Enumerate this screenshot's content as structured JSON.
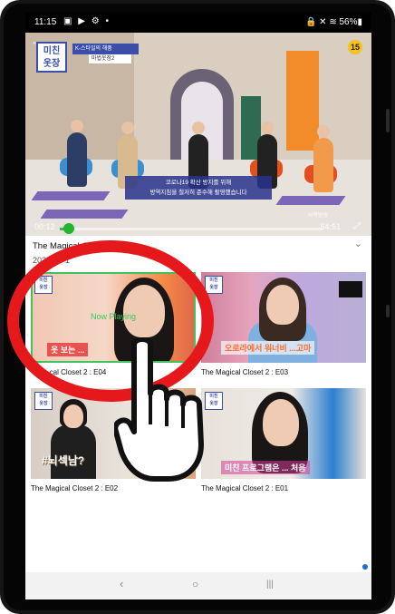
{
  "status_bar": {
    "time": "11:15",
    "left_icons": "▣ ▶ ⚙ •",
    "right_icons": "🔒 ✕ ≋ 56%▮",
    "battery": "56%"
  },
  "player": {
    "show_logo": "미친\n옷장",
    "top_banner": "K-스타일의 해품",
    "top_banner_sub": "마법옷장2",
    "rating": "15",
    "subtitle_line1": "코로나19 확산 방지를 위해",
    "subtitle_line2": "방역지침을 철저히 준수해 촬영했습니다",
    "corner_label": "사적방송",
    "current_time": "00:12",
    "total_time": "54:51",
    "progress_fraction": 0.02
  },
  "episode": {
    "title": "The Magical Closet 2 : E04",
    "date": "2022-04-1"
  },
  "grid": [
    {
      "label": "...cal Closet 2 : E04",
      "caption": "옷 보는 ...",
      "now_playing": "Now Playing"
    },
    {
      "label": "The Magical Closet 2 : E03",
      "caption": "오로라에서 워너비 ...고마"
    },
    {
      "label": "The Magical Closet 2 : E02",
      "caption": "#뇌섹남?"
    },
    {
      "label": "The Magical Closet 2 : E01",
      "caption": "미친 프로그램은 ... 처음"
    }
  ],
  "icons": {
    "back": "←",
    "chevron": "⌄",
    "fullscreen": "⤢",
    "nav_back": "‹",
    "nav_home": "○",
    "nav_recents": "|||"
  },
  "colors": {
    "accent_green": "#21b530",
    "annotation_red": "#e5191b",
    "logo_blue": "#3b4ea8"
  }
}
